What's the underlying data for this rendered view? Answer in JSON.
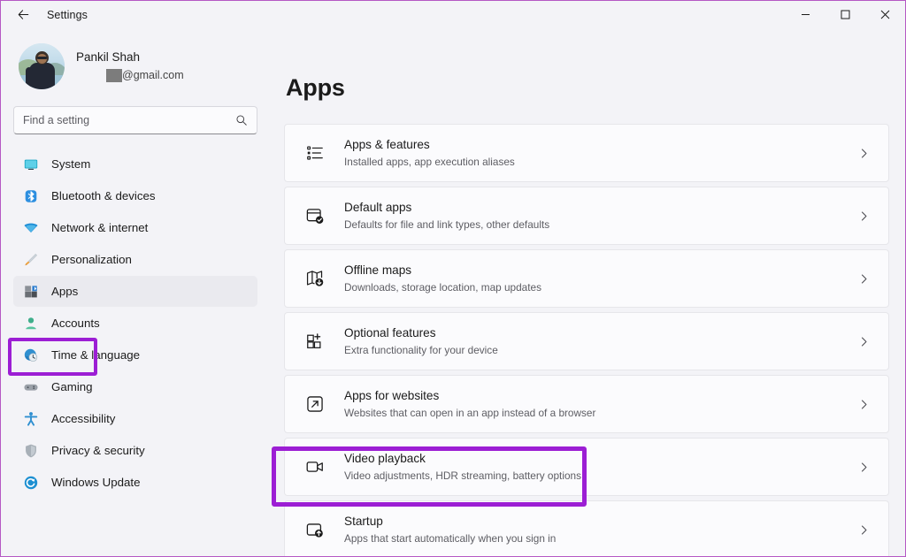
{
  "titlebar": {
    "title": "Settings",
    "back_icon": "back-arrow-icon",
    "minimize_label": "─",
    "maximize_label": "☐",
    "close_label": "✕"
  },
  "account": {
    "name": "Pankil Shah",
    "email_redacted": "",
    "email_domain": "@gmail.com",
    "avatar_alt": "user-avatar"
  },
  "search": {
    "placeholder": "Find a setting",
    "value": "",
    "icon": "search-icon"
  },
  "sidebar": {
    "items": [
      {
        "label": "System",
        "icon": "monitor-icon",
        "selected": false
      },
      {
        "label": "Bluetooth & devices",
        "icon": "bluetooth-icon",
        "selected": false
      },
      {
        "label": "Network & internet",
        "icon": "wifi-icon",
        "selected": false
      },
      {
        "label": "Personalization",
        "icon": "paintbrush-icon",
        "selected": false
      },
      {
        "label": "Apps",
        "icon": "apps-icon",
        "selected": true
      },
      {
        "label": "Accounts",
        "icon": "person-icon",
        "selected": false
      },
      {
        "label": "Time & language",
        "icon": "clock-globe-icon",
        "selected": false
      },
      {
        "label": "Gaming",
        "icon": "gamepad-icon",
        "selected": false
      },
      {
        "label": "Accessibility",
        "icon": "accessibility-icon",
        "selected": false
      },
      {
        "label": "Privacy & security",
        "icon": "shield-icon",
        "selected": false
      },
      {
        "label": "Windows Update",
        "icon": "update-icon",
        "selected": false
      }
    ]
  },
  "main": {
    "title": "Apps",
    "cards": [
      {
        "title": "Apps & features",
        "subtitle": "Installed apps, app execution aliases",
        "icon": "list-bullet-icon",
        "chevron": "chevron-right-icon"
      },
      {
        "title": "Default apps",
        "subtitle": "Defaults for file and link types, other defaults",
        "icon": "default-apps-icon",
        "chevron": "chevron-right-icon"
      },
      {
        "title": "Offline maps",
        "subtitle": "Downloads, storage location, map updates",
        "icon": "map-download-icon",
        "chevron": "chevron-right-icon"
      },
      {
        "title": "Optional features",
        "subtitle": "Extra functionality for your device",
        "icon": "grid-plus-icon",
        "chevron": "chevron-right-icon"
      },
      {
        "title": "Apps for websites",
        "subtitle": "Websites that can open in an app instead of a browser",
        "icon": "external-link-icon",
        "chevron": "chevron-right-icon"
      },
      {
        "title": "Video playback",
        "subtitle": "Video adjustments, HDR streaming, battery options",
        "icon": "video-camera-icon",
        "chevron": "chevron-right-icon"
      },
      {
        "title": "Startup",
        "subtitle": "Apps that start automatically when you sign in",
        "icon": "startup-icon",
        "chevron": "chevron-right-icon"
      }
    ]
  },
  "annotations": {
    "highlight_color": "#9c1ed4",
    "window_border_color": "#b558c4",
    "highlighted_sidebar_item": "Apps",
    "highlighted_card": "Video playback"
  }
}
